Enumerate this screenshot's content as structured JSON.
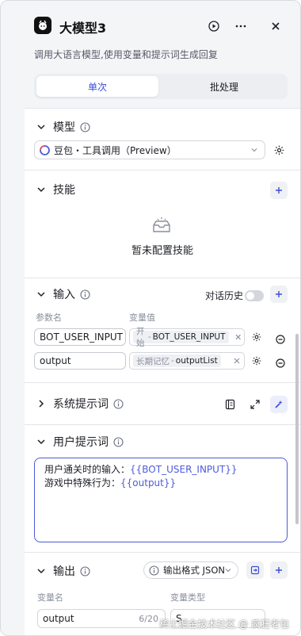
{
  "header": {
    "title": "大模型3",
    "description": "调用大语言模型,使用变量和提示词生成回复"
  },
  "tabs": [
    {
      "label": "单次",
      "active": true
    },
    {
      "label": "批处理",
      "active": false
    }
  ],
  "model": {
    "title": "模型",
    "selected": "豆包・工具调用（Preview）"
  },
  "skills": {
    "title": "技能",
    "empty_text": "暂未配置技能"
  },
  "input": {
    "title": "输入",
    "history_label": "对话历史",
    "history_enabled": false,
    "col_param": "参数名",
    "col_value": "变量值",
    "rows": [
      {
        "name": "BOT_USER_INPUT",
        "source": "开始",
        "value": "BOT_USER_INPUT"
      },
      {
        "name": "output",
        "source": "长期记忆",
        "value": "outputList"
      }
    ]
  },
  "system_prompt": {
    "title": "系统提示词"
  },
  "user_prompt": {
    "title": "用户提示词",
    "line1_prefix": "用户通关时的输入：",
    "line1_var": "{{BOT_USER_INPUT}}",
    "line2_prefix": "游戏中特殊行为：",
    "line2_var": "{{output}}"
  },
  "output": {
    "title": "输出",
    "format_label": "输出格式 JSON",
    "col_name": "变量名",
    "col_type": "变量类型",
    "rows": [
      {
        "name": "output",
        "count": "6/20",
        "type": "S"
      }
    ]
  },
  "watermark": "稀土掘金技术社区 @ 疯狂老包",
  "colors": {
    "accent": "#3b4dd8",
    "border_focus": "#4e5bd9"
  }
}
